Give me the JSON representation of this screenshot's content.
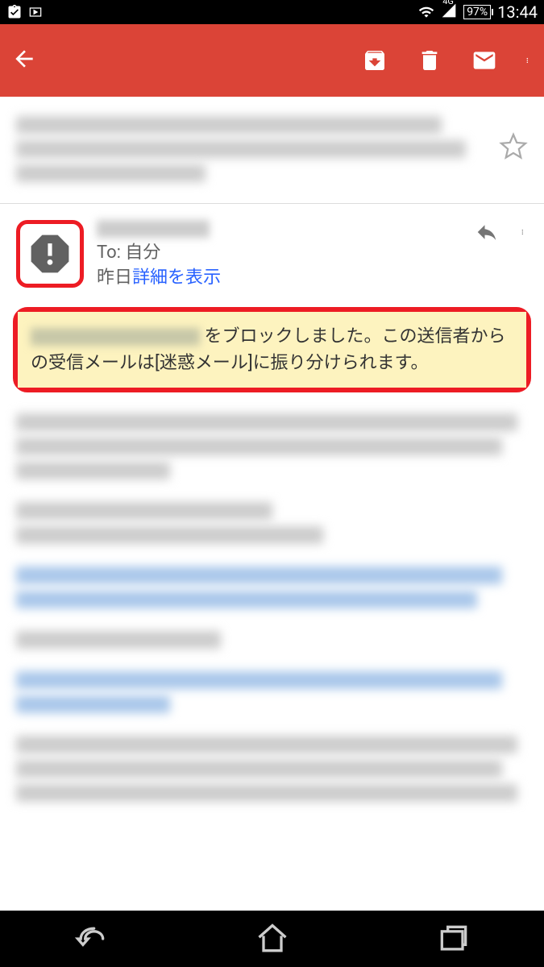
{
  "status": {
    "network": "4G",
    "battery": "97%",
    "time": "13:44"
  },
  "toolbar": {
    "back_icon": "arrow-back",
    "archive_icon": "archive",
    "delete_icon": "delete",
    "unread_icon": "mark-unread",
    "more_icon": "more-vert"
  },
  "email": {
    "sender_to_prefix": "To: ",
    "sender_to": "自分",
    "date": "昨日",
    "details_link": "詳細を表示"
  },
  "banner": {
    "text_after": " をブロックしました。この送信者からの受信メールは[迷惑メール]に振り分けられます。"
  }
}
